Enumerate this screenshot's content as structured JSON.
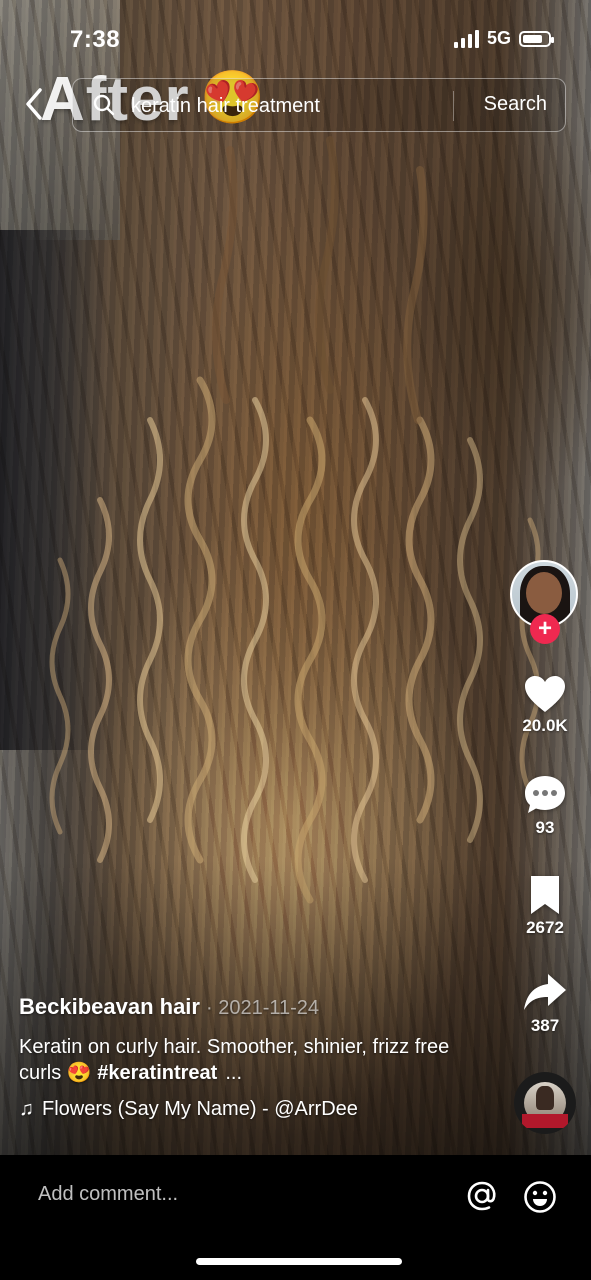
{
  "status_bar": {
    "time": "7:38",
    "network": "5G",
    "battery_level": 0.8
  },
  "overlay": {
    "caption": "After",
    "emoji": "😍"
  },
  "search": {
    "query": "keratin hair treatment",
    "button_label": "Search"
  },
  "rail": {
    "likes": "20.0K",
    "comments": "93",
    "saves": "2672",
    "shares": "387",
    "follow": "+"
  },
  "post": {
    "author": "Beckibeavan hair",
    "date": "· 2021-11-24",
    "description": "Keratin on curly hair. Smoother, shinier, frizz free curls",
    "emoji": "😍",
    "hashtag": "#keratintreat",
    "more": "...",
    "music_note": "♫",
    "music": "Flowers (Say My Name) - @ArrDee"
  },
  "comment_bar": {
    "placeholder": "Add comment..."
  },
  "colors": {
    "accent": "#ef2950",
    "background": "#000000",
    "text": "#ffffff"
  }
}
